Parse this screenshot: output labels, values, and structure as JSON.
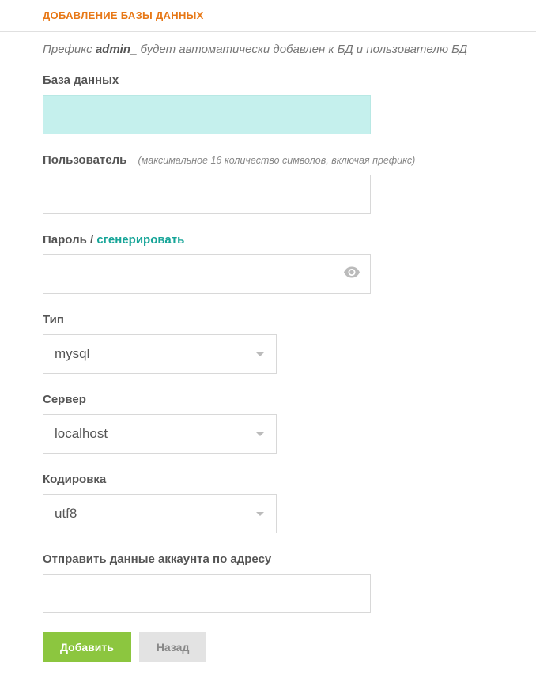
{
  "header": {
    "title": "ДОБАВЛЕНИЕ БАЗЫ ДАННЫХ"
  },
  "prefix_note": {
    "before": "Префикс ",
    "prefix": "admin_",
    "after": " будет автоматически добавлен к БД и пользователю БД"
  },
  "fields": {
    "database": {
      "label": "База данных",
      "value": ""
    },
    "user": {
      "label": "Пользователь",
      "hint": "(максимальное 16 количество символов, включая префикс)",
      "value": ""
    },
    "password": {
      "label": "Пароль",
      "separator": " / ",
      "generate": "сгенерировать",
      "value": ""
    },
    "type": {
      "label": "Тип",
      "value": "mysql"
    },
    "server": {
      "label": "Сервер",
      "value": "localhost"
    },
    "encoding": {
      "label": "Кодировка",
      "value": "utf8"
    },
    "send_email": {
      "label": "Отправить данные аккаунта по адресу",
      "value": ""
    }
  },
  "buttons": {
    "add": "Добавить",
    "back": "Назад"
  }
}
